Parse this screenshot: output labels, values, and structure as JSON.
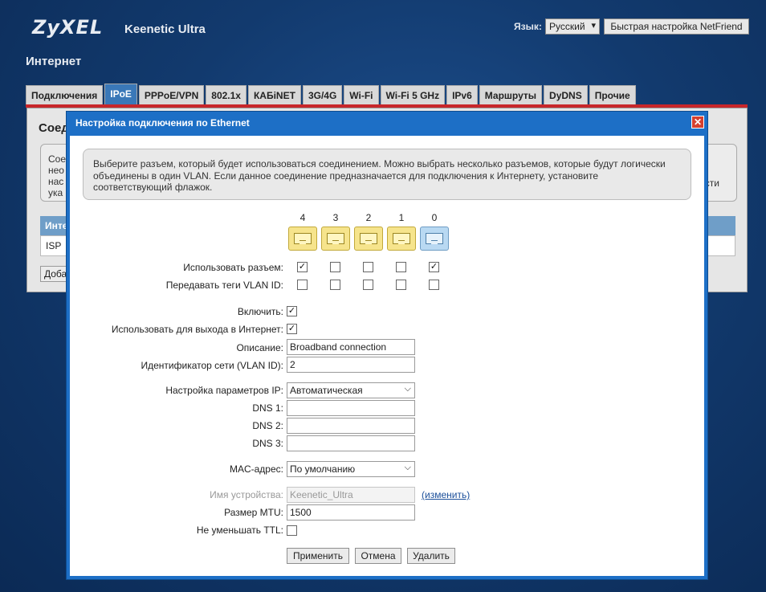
{
  "header": {
    "logo": "ZyXEL",
    "model": "Keenetic Ultra",
    "language_label": "Язык:",
    "language_value": "Русский",
    "quick_setup_button": "Быстрая настройка NetFriend",
    "section_title": "Интернет"
  },
  "tabs": [
    "Подключения",
    "IPoE",
    "PPPoE/VPN",
    "802.1x",
    "КАБiNET",
    "3G/4G",
    "Wi-Fi",
    "Wi-Fi 5 GHz",
    "IPv6",
    "Маршруты",
    "DyDNS",
    "Прочие"
  ],
  "background_page": {
    "heading": "Соед",
    "box_lines": [
      "Сое",
      "нео",
      "нас",
      "ука"
    ],
    "box_right": "сти",
    "table_header": "Инте",
    "table_row": "ISP",
    "add_button": "Доба"
  },
  "dialog": {
    "title": "Настройка подключения по Ethernet",
    "close_symbol": "✕",
    "info_text_lines": [
      "Выберите разъем, который будет использоваться соединением. Можно выбрать несколько разъемов, которые будут логически",
      "объединены в один VLAN. Если данное соединение предназначается для подключения к Интернету, установите",
      "соответствующий флажок."
    ],
    "ports": [
      {
        "number": "4",
        "color": "yellow",
        "use": true,
        "vlan_tag": false
      },
      {
        "number": "3",
        "color": "yellow",
        "use": false,
        "vlan_tag": false
      },
      {
        "number": "2",
        "color": "yellow",
        "use": false,
        "vlan_tag": false
      },
      {
        "number": "1",
        "color": "yellow",
        "use": false,
        "vlan_tag": false
      },
      {
        "number": "0",
        "color": "blue",
        "use": true,
        "vlan_tag": false
      }
    ],
    "labels": {
      "use_port": "Использовать разъем:",
      "vlan_tags": "Передавать теги VLAN ID:",
      "enable": "Включить:",
      "use_for_internet": "Использовать для выхода в Интернет:",
      "description": "Описание:",
      "vlan_id": "Идентификатор сети (VLAN ID):",
      "ip_settings": "Настройка параметров IP:",
      "dns1": "DNS 1:",
      "dns2": "DNS 2:",
      "dns3": "DNS 3:",
      "mac": "MAC-адрес:",
      "device_name": "Имя устройства:",
      "mtu": "Размер MTU:",
      "no_ttl": "Не уменьшать TTL:"
    },
    "values": {
      "enable": true,
      "use_for_internet": true,
      "description": "Broadband connection",
      "vlan_id": "2",
      "ip_settings": "Автоматическая",
      "dns1": "",
      "dns2": "",
      "dns3": "",
      "mac": "По умолчанию",
      "device_name": "Keenetic_Ultra",
      "mtu": "1500",
      "no_ttl": false
    },
    "change_link": "(изменить)",
    "buttons": {
      "apply": "Применить",
      "cancel": "Отмена",
      "delete": "Удалить"
    },
    "check_symbol": "✓",
    "chevron_symbol": "⌵"
  },
  "colors": {
    "tab_active": "#3a78b8",
    "dialog_frame": "#1d6fc6",
    "port_yellow": "#f6e48c",
    "port_blue": "#b9d9f2",
    "accent_red": "#c8262a"
  }
}
